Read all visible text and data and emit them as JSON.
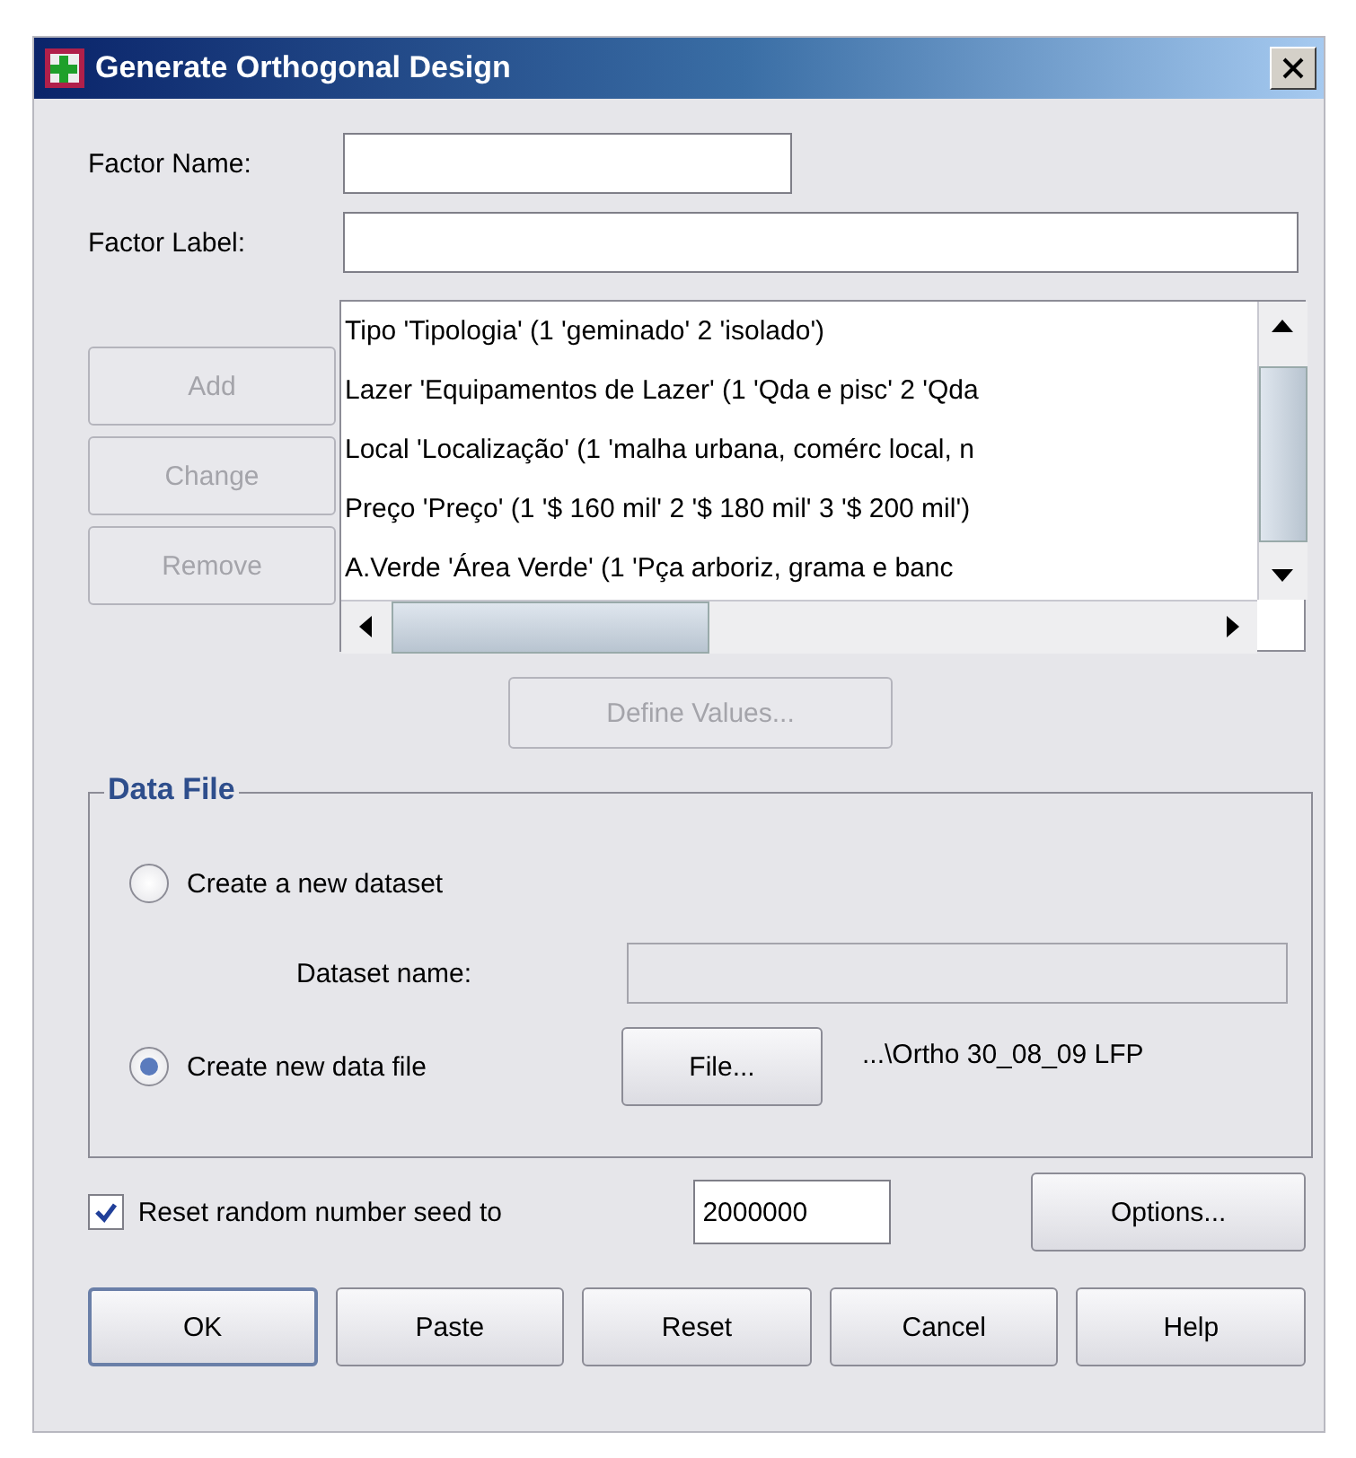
{
  "window": {
    "title": "Generate Orthogonal Design"
  },
  "factor_name": {
    "label": "Factor Name:"
  },
  "factor_label": {
    "label": "Factor Label:"
  },
  "factor_buttons": [
    {
      "label": "Add",
      "disabled": true
    },
    {
      "label": "Change",
      "disabled": true
    },
    {
      "label": "Remove",
      "disabled": true
    }
  ],
  "factors": [
    "Tipo 'Tipologia' (1 'geminado' 2 'isolado')",
    "Lazer 'Equipamentos de Lazer' (1 'Qda e pisc' 2 'Qda",
    "Local 'Localização' (1 'malha urbana, comérc local, n",
    "Preço 'Preço' (1 '$ 160 mil' 2 '$ 180 mil' 3 '$ 200 mil')",
    "A.Verde 'Área Verde' (1 'Pça arboriz, grama e banc"
  ],
  "define_values": {
    "label": "Define Values...",
    "disabled": true
  },
  "data_file": {
    "title": "Data File",
    "options": [
      {
        "label": "Create a new dataset",
        "selected": false
      },
      {
        "label": "Create new data file",
        "selected": true
      }
    ],
    "dataset_name": {
      "label": "Dataset name:",
      "disabled": true
    },
    "file_button": "File...",
    "file_path": "...\\Ortho 30_08_09 LFP"
  },
  "seed": {
    "label": "Reset random number seed to",
    "checked": true,
    "value": "2000000"
  },
  "options_button": "Options...",
  "buttons": [
    {
      "label": "OK",
      "default": true
    },
    {
      "label": "Paste",
      "default": false
    },
    {
      "label": "Reset",
      "default": false
    },
    {
      "label": "Cancel",
      "default": false
    },
    {
      "label": "Help",
      "default": false
    }
  ]
}
